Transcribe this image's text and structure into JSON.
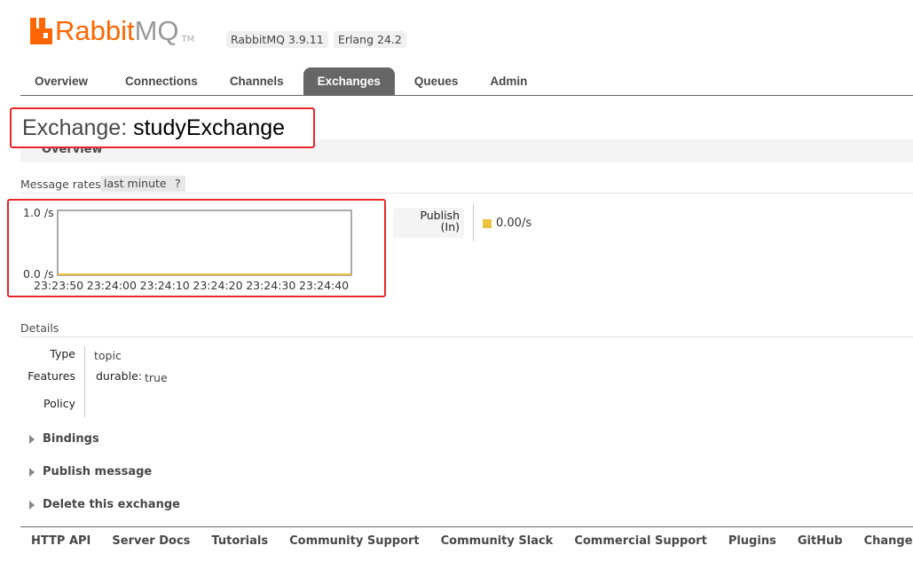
{
  "header": {
    "brand_left": "Rabbit",
    "brand_right": "MQ",
    "trademark": "TM",
    "version": "RabbitMQ 3.9.11",
    "erlang": "Erlang 24.2"
  },
  "nav": {
    "tabs": [
      {
        "label": "Overview"
      },
      {
        "label": "Connections"
      },
      {
        "label": "Channels"
      },
      {
        "label": "Exchanges",
        "active": true
      },
      {
        "label": "Queues"
      },
      {
        "label": "Admin"
      }
    ]
  },
  "page": {
    "title_prefix": "Exchange: ",
    "title_name": "studyExchange"
  },
  "overview": {
    "label": "Overview",
    "rates_label": "Message rates",
    "rates_range": "last minute",
    "rates_help": "?"
  },
  "chart_data": {
    "type": "line",
    "x": [
      "23:23:50",
      "23:24:00",
      "23:24:10",
      "23:24:20",
      "23:24:30",
      "23:24:40"
    ],
    "ytick_labels": [
      "1.0 /s",
      "0.0 /s"
    ],
    "ylim": [
      0,
      1
    ],
    "series": [
      {
        "name": "Publish (In)",
        "values": [
          0,
          0,
          0,
          0,
          0,
          0
        ],
        "color": "#edc240"
      }
    ]
  },
  "legend": {
    "label_line1": "Publish",
    "label_line2": "(In)",
    "value": "0.00/s"
  },
  "details": {
    "label": "Details",
    "type_key": "Type",
    "type_val": "topic",
    "features_key": "Features",
    "feature_name": "durable:",
    "feature_value": "true",
    "policy_key": "Policy"
  },
  "sections": [
    {
      "label": "Bindings"
    },
    {
      "label": "Publish message"
    },
    {
      "label": "Delete this exchange"
    }
  ],
  "footer": {
    "links": [
      {
        "label": "HTTP API"
      },
      {
        "label": "Server Docs"
      },
      {
        "label": "Tutorials"
      },
      {
        "label": "Community Support"
      },
      {
        "label": "Community Slack"
      },
      {
        "label": "Commercial Support"
      },
      {
        "label": "Plugins"
      },
      {
        "label": "GitHub"
      },
      {
        "label": "Changelog"
      }
    ]
  },
  "colors": {
    "brand": "#ff6600",
    "highlight_border": "#e8262b",
    "series": "#edc240"
  }
}
